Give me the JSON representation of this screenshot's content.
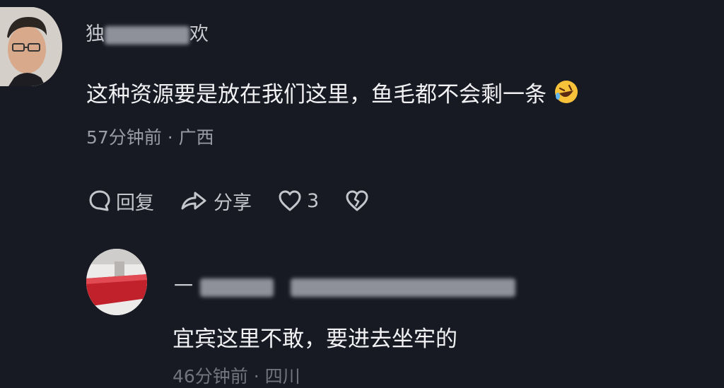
{
  "comment1": {
    "author_visible": "独",
    "author_tail": "欢",
    "text": "这种资源要是放在我们这里，鱼毛都不会剩一条",
    "emoji_name": "rolling-on-floor-laughing-emoji",
    "time_location": "57分钟前 · 广西",
    "reply_label": "回复",
    "share_label": "分享",
    "like_count": "3"
  },
  "comment2": {
    "author_visible": "一",
    "text": "宜宾这里不敢，要进去坐牢的",
    "time_location": "46分钟前 · 四川"
  },
  "colors": {
    "background": "#171a23",
    "text": "#f2f2f4",
    "meta": "#9a9ba4"
  }
}
